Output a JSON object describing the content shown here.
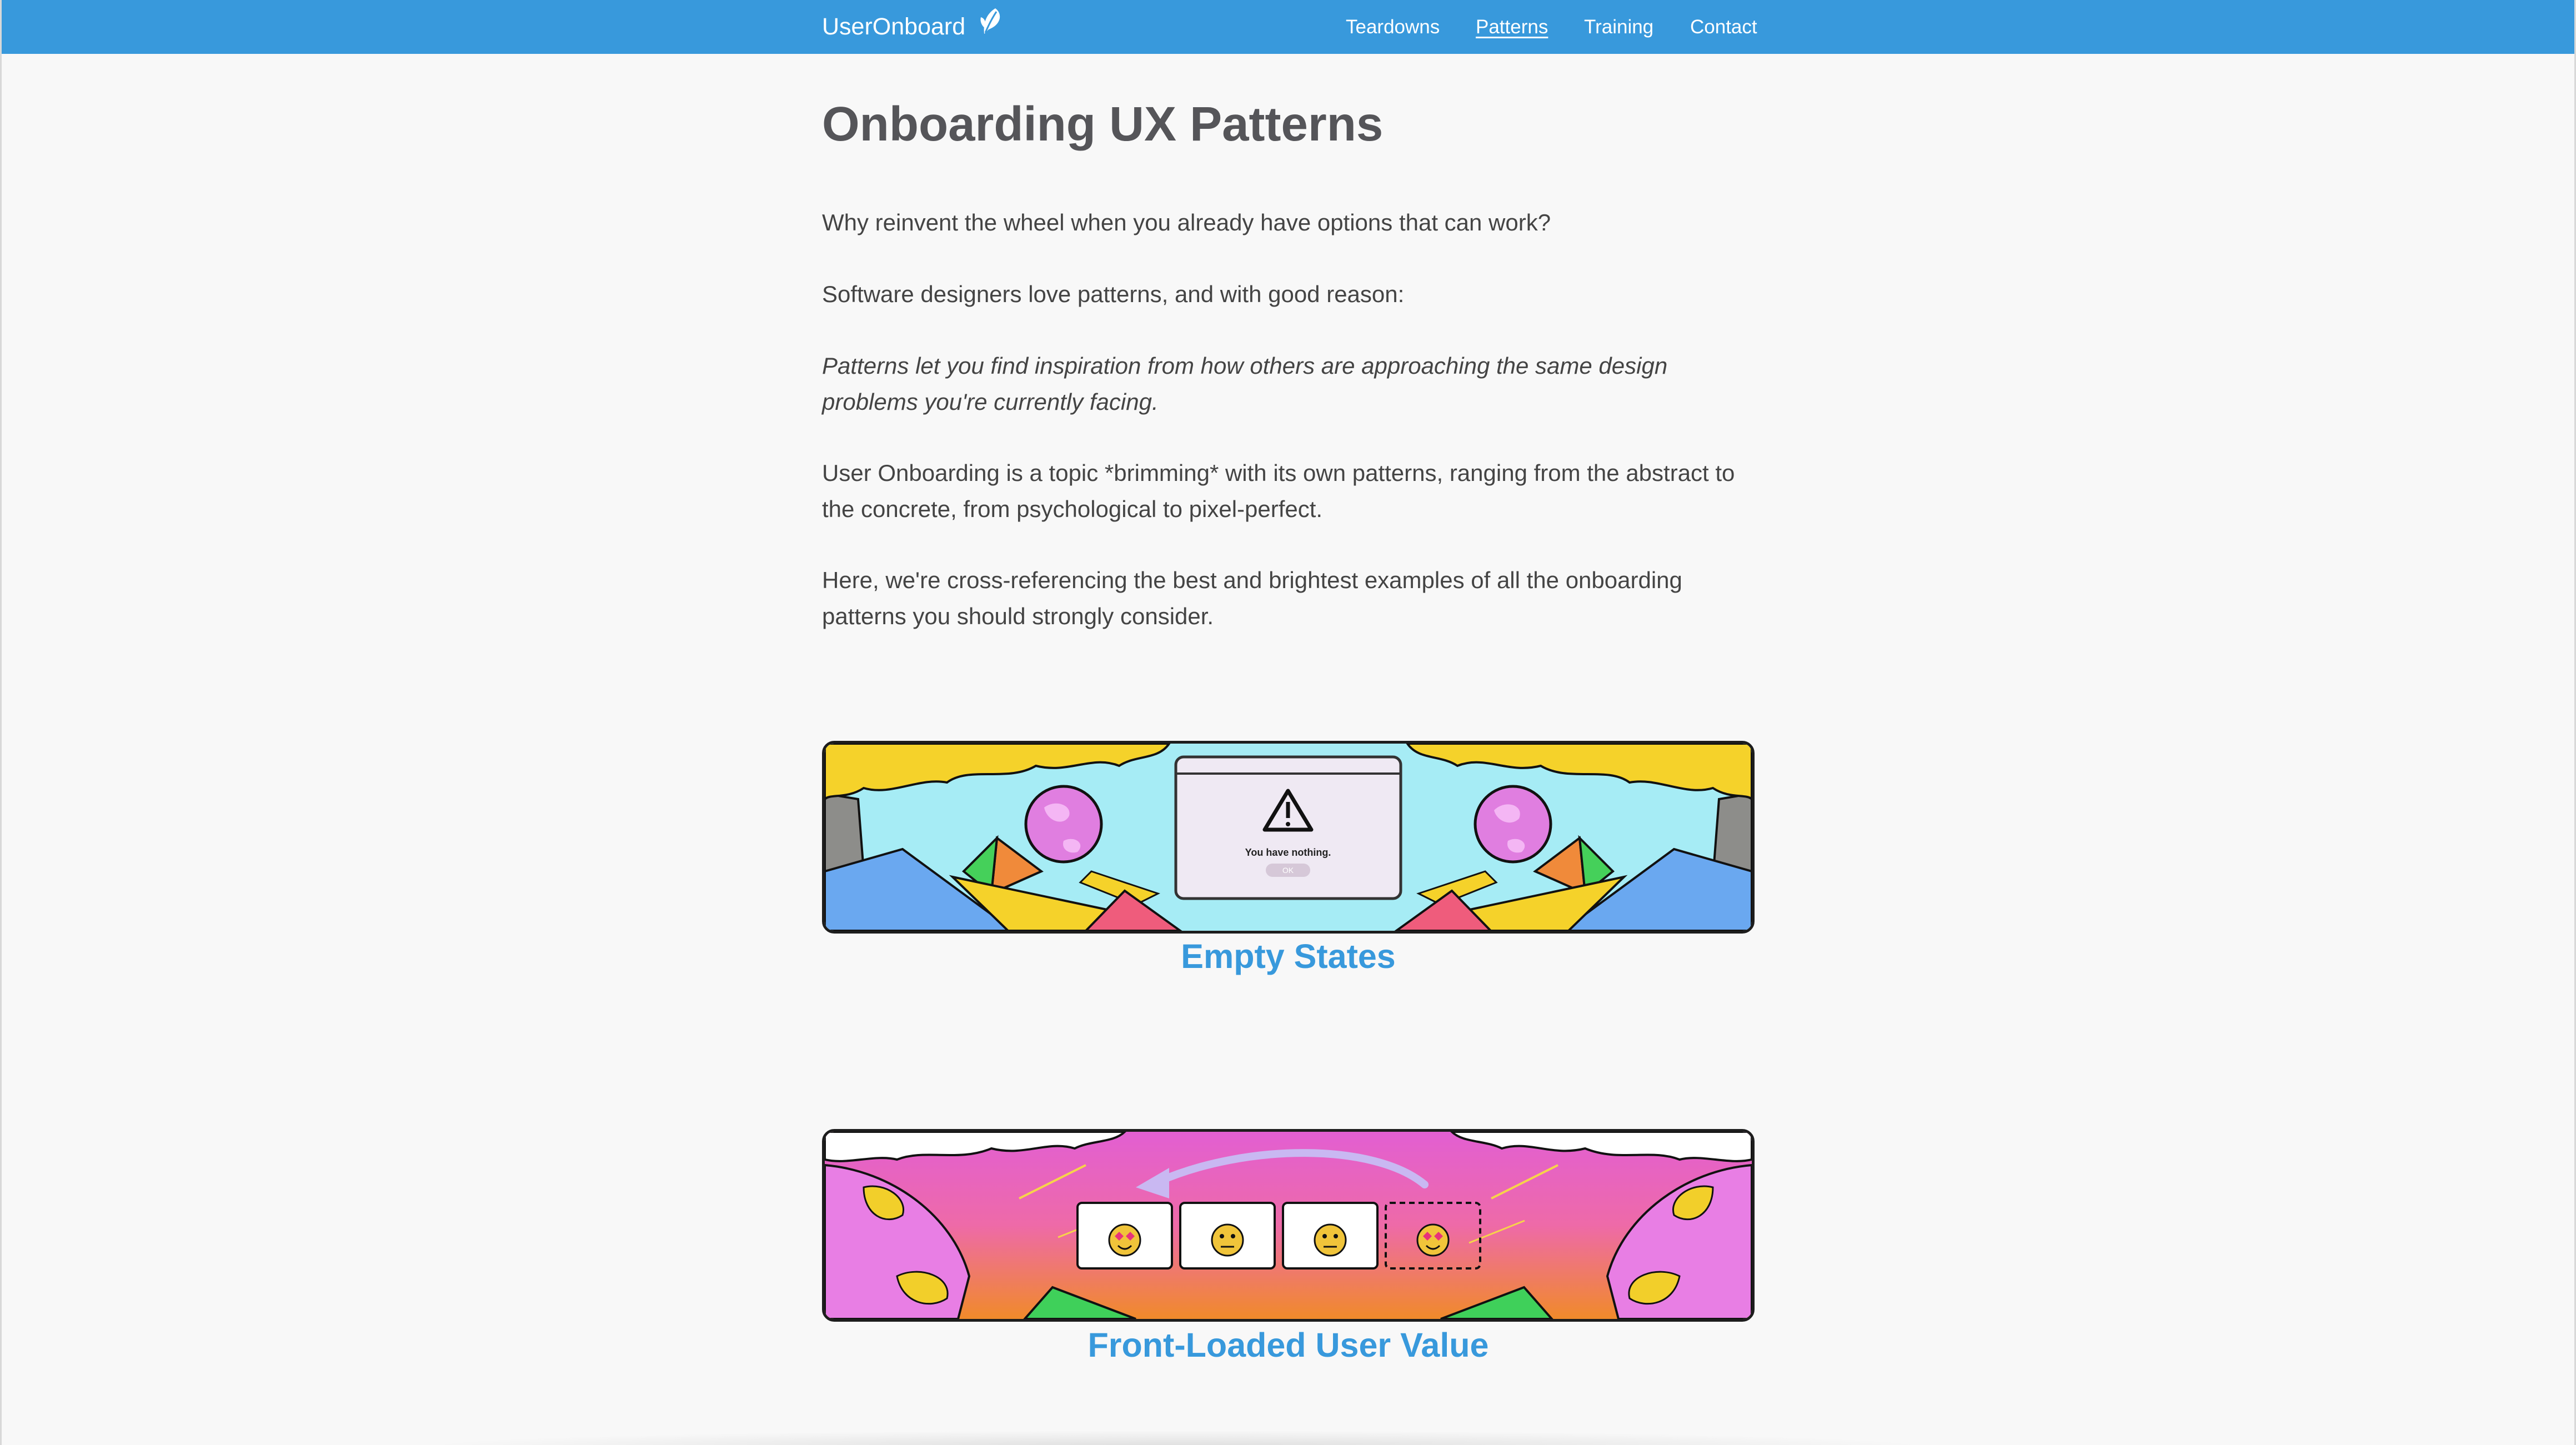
{
  "header": {
    "brand": "UserOnboard",
    "brand_icon": "leaf-icon",
    "nav": [
      {
        "label": "Teardowns",
        "active": false
      },
      {
        "label": "Patterns",
        "active": true
      },
      {
        "label": "Training",
        "active": false
      },
      {
        "label": "Contact",
        "active": false
      }
    ],
    "bar_color": "#3899dc"
  },
  "main": {
    "title": "Onboarding UX Patterns",
    "paragraphs": [
      {
        "text": "Why reinvent the wheel when you already have options that can work?"
      },
      {
        "text": "Software designers love patterns, and with good reason:"
      },
      {
        "text": "Patterns let you find inspiration from how others are approaching the same design problems you're currently facing."
      },
      {
        "text": "User Onboarding is a topic *brimming* with its own patterns, ranging from the abstract to the concrete, from psychological to pixel-perfect."
      },
      {
        "text": "Here, we're cross-referencing the best and brightest examples of all the onboarding patterns you should strongly consider."
      }
    ],
    "patterns": [
      {
        "title": "Empty States",
        "dialog_text": "You have nothing.",
        "dialog_button": "OK"
      },
      {
        "title": "Front-Loaded User Value"
      }
    ]
  },
  "colors": {
    "accent": "#3899dc",
    "text": "#444444",
    "heading": "#555559",
    "background": "#f8f8f8"
  }
}
